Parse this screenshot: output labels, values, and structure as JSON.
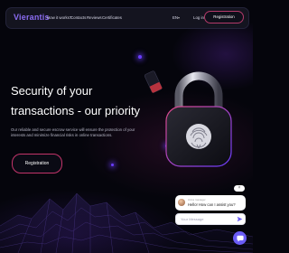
{
  "brand": {
    "logo_text": "Vierantis"
  },
  "nav": {
    "links": [
      "How it works?",
      "Contacts",
      "Reviews",
      "Certificates"
    ],
    "language": "EN",
    "login_label": "Log in",
    "register_label": "Registration"
  },
  "hero": {
    "title_line1": "Security of your",
    "title_line2": "transactions - our priority",
    "description": "Our reliable and secure escrow service will ensure the protection of your interests and minimize financial risks in online transactions.",
    "cta_label": "Registration"
  },
  "chat": {
    "close_label": "Close",
    "agent_name": "Anna manager",
    "message": "Hello! How can I assist you?",
    "input_placeholder": "Your Message"
  },
  "colors": {
    "accent": "#8b6cf2",
    "button_border": "#c3346a",
    "chat_accent": "#6b5cf6"
  }
}
